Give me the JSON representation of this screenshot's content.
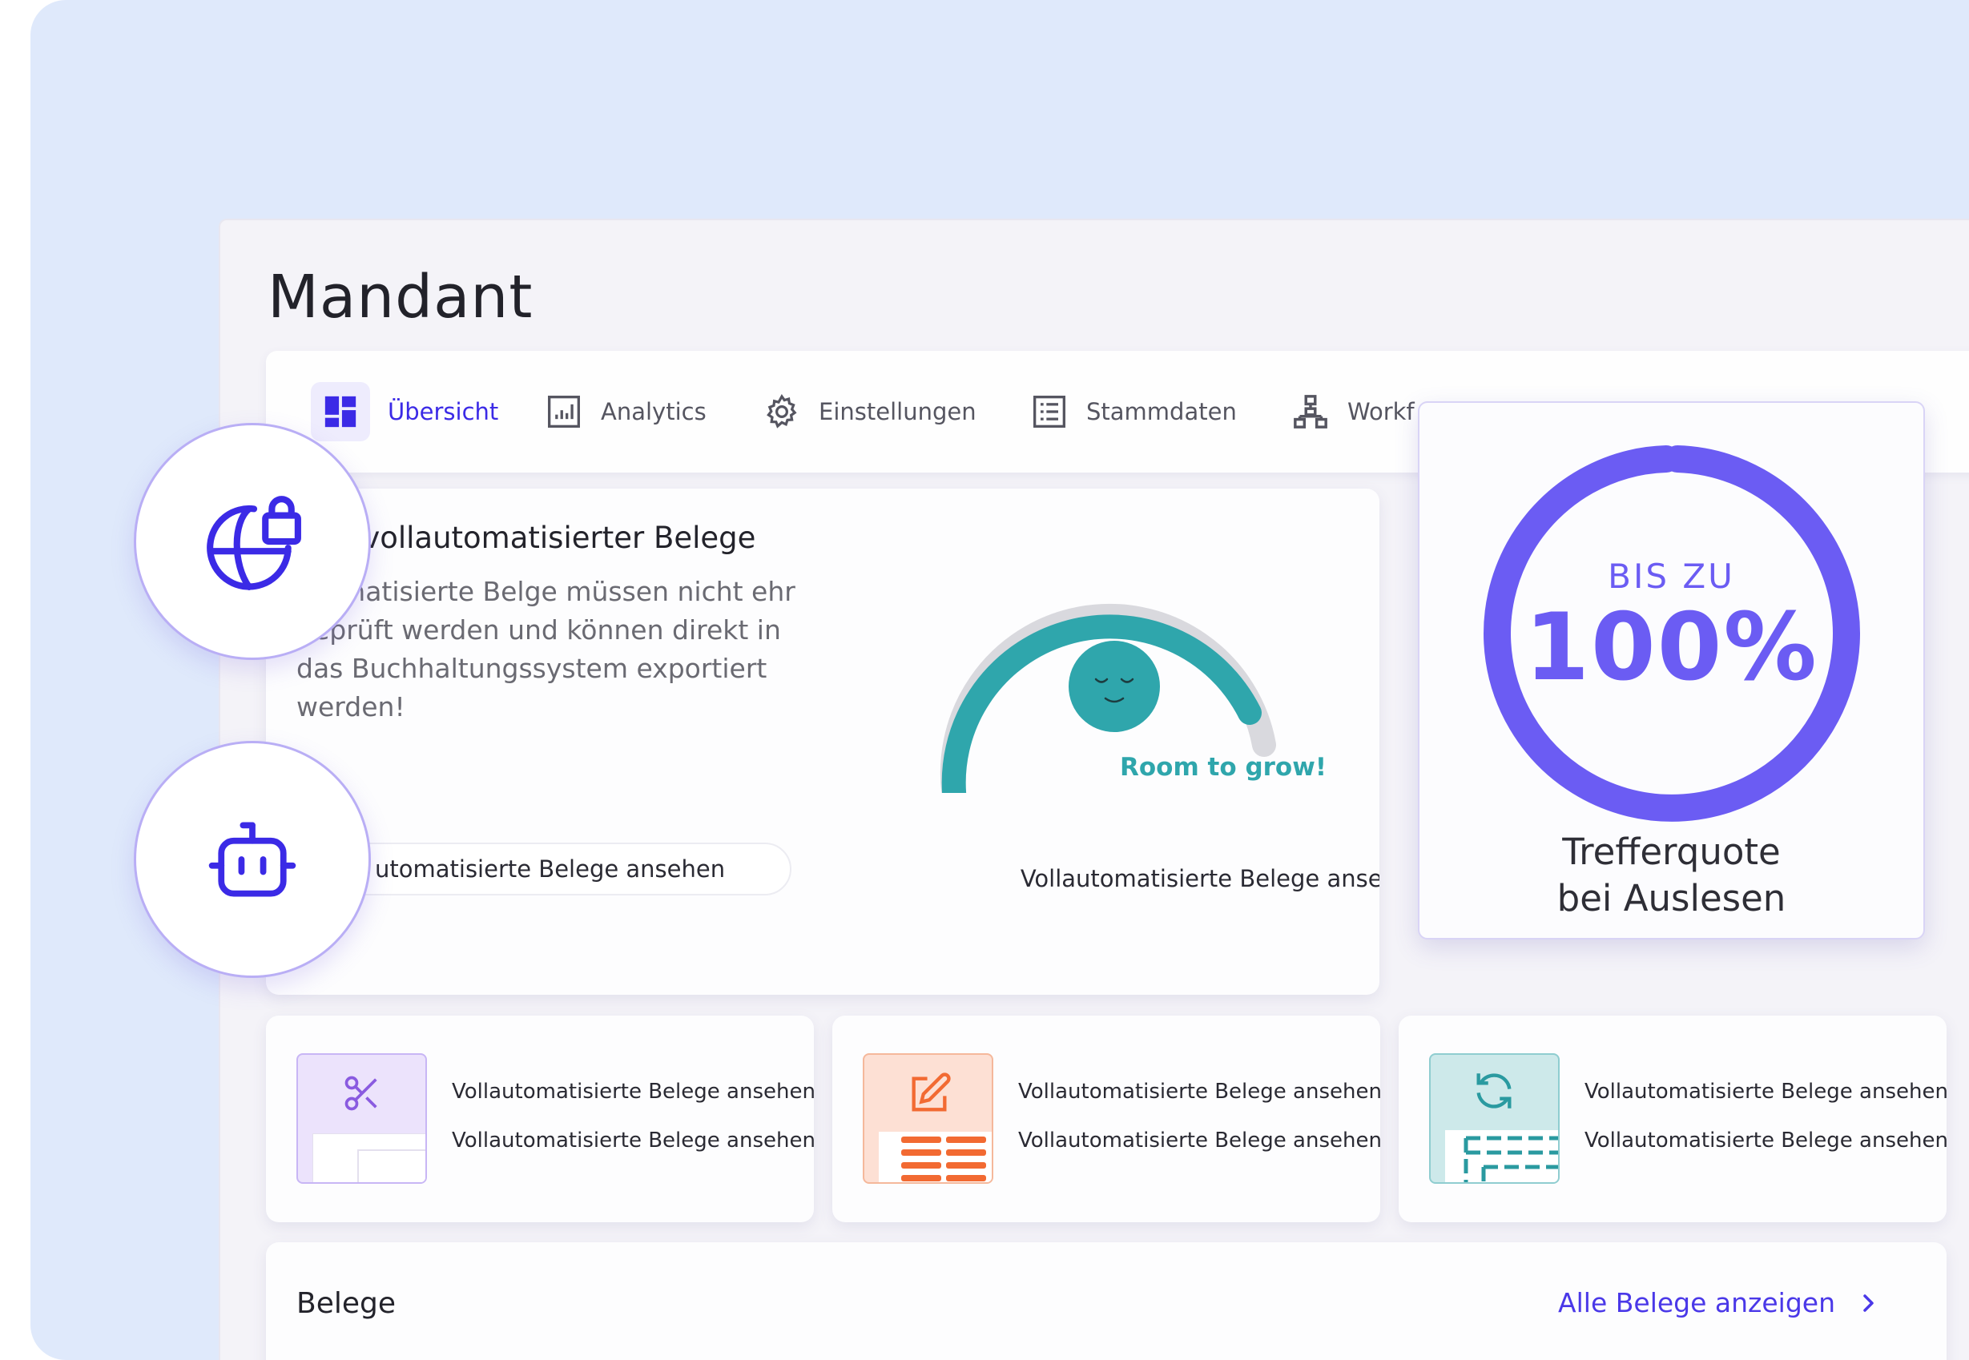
{
  "page": {
    "title": "Mandant"
  },
  "tabs": [
    {
      "label": "Übersicht",
      "icon": "dashboard-icon",
      "active": true
    },
    {
      "label": "Analytics",
      "icon": "bar-chart-icon",
      "active": false
    },
    {
      "label": "Einstellungen",
      "icon": "gear-icon",
      "active": false
    },
    {
      "label": "Stammdaten",
      "icon": "list-icon",
      "active": false
    },
    {
      "label": "Workf",
      "icon": "sitemap-icon",
      "active": false
    }
  ],
  "auto_card": {
    "title": "il vollautomatisierter Belege",
    "description": "utomatisierte Belge müssen nicht ehr geprüft werden und können direkt in das Buchhaltungssystem exportiert werden!",
    "button_label": "utomatisierte Belege ansehen",
    "gauge_label": "Room to grow!",
    "gauge_link": "Vollautomatisierte Belege ansehen"
  },
  "hit_rate": {
    "prefix": "BIS ZU",
    "value": "100%",
    "caption_line1": "Trefferquote",
    "caption_line2": "bei Auslesen"
  },
  "features": [
    {
      "icon": "scissors-icon",
      "line1": "Vollautomatisierte Belege ansehen",
      "line2": "Vollautomatisierte Belege ansehen"
    },
    {
      "icon": "edit-icon",
      "line1": "Vollautomatisierte Belege ansehen",
      "line2": "Vollautomatisierte Belege ansehen"
    },
    {
      "icon": "refresh-icon",
      "line1": "Vollautomatisierte Belege ansehen",
      "line2": "Vollautomatisierte Belege ansehen"
    }
  ],
  "belege": {
    "title": "Belege",
    "link_label": "Alle Belege anzeigen"
  },
  "colors": {
    "accent": "#3b2ae6",
    "ring": "#6b5cf3",
    "teal": "#2fa6ac",
    "orange": "#f26a32",
    "background": "#dfe9fb"
  }
}
